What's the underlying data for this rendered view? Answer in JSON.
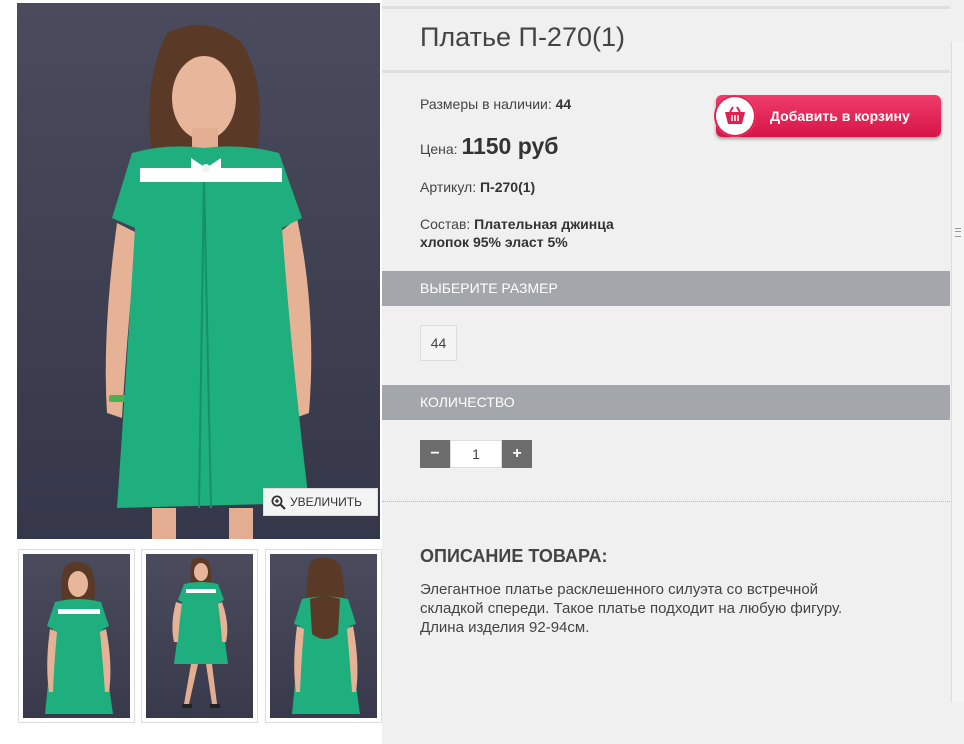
{
  "product": {
    "title": "Платье П-270(1)",
    "sizes_label": "Размеры в наличии:",
    "sizes_value": "44",
    "price_label": "Цена:",
    "price_value": "1150 руб",
    "sku_label": "Артикул:",
    "sku_value": "П-270(1)",
    "composition_label": "Состав:",
    "composition_value_1": "Плательная джинца",
    "composition_value_2": "хлопок 95% эласт 5%"
  },
  "cart_button": {
    "label": "Добавить в корзину",
    "icon": "basket-icon",
    "color": "#e0204f"
  },
  "gallery": {
    "zoom_label": "УВЕЛИЧИТЬ",
    "zoom_icon": "magnifier-plus-icon",
    "dress_color": "#1fae7e",
    "thumbnails": [
      "front",
      "full-length",
      "back"
    ]
  },
  "size_section": {
    "title": "ВЫБЕРИТЕ РАЗМЕР",
    "options": [
      "44"
    ]
  },
  "quantity_section": {
    "title": "КОЛИЧЕСТВО",
    "value": "1",
    "minus": "−",
    "plus": "+"
  },
  "description": {
    "title": "ОПИСАНИЕ ТОВАРА:",
    "line1": "Элегантное платье расклешенного силуэта со встречной",
    "line2": "складкой спереди. Такое платье подходит на любую фигуру.",
    "line3": "Длина изделия 92-94см."
  }
}
